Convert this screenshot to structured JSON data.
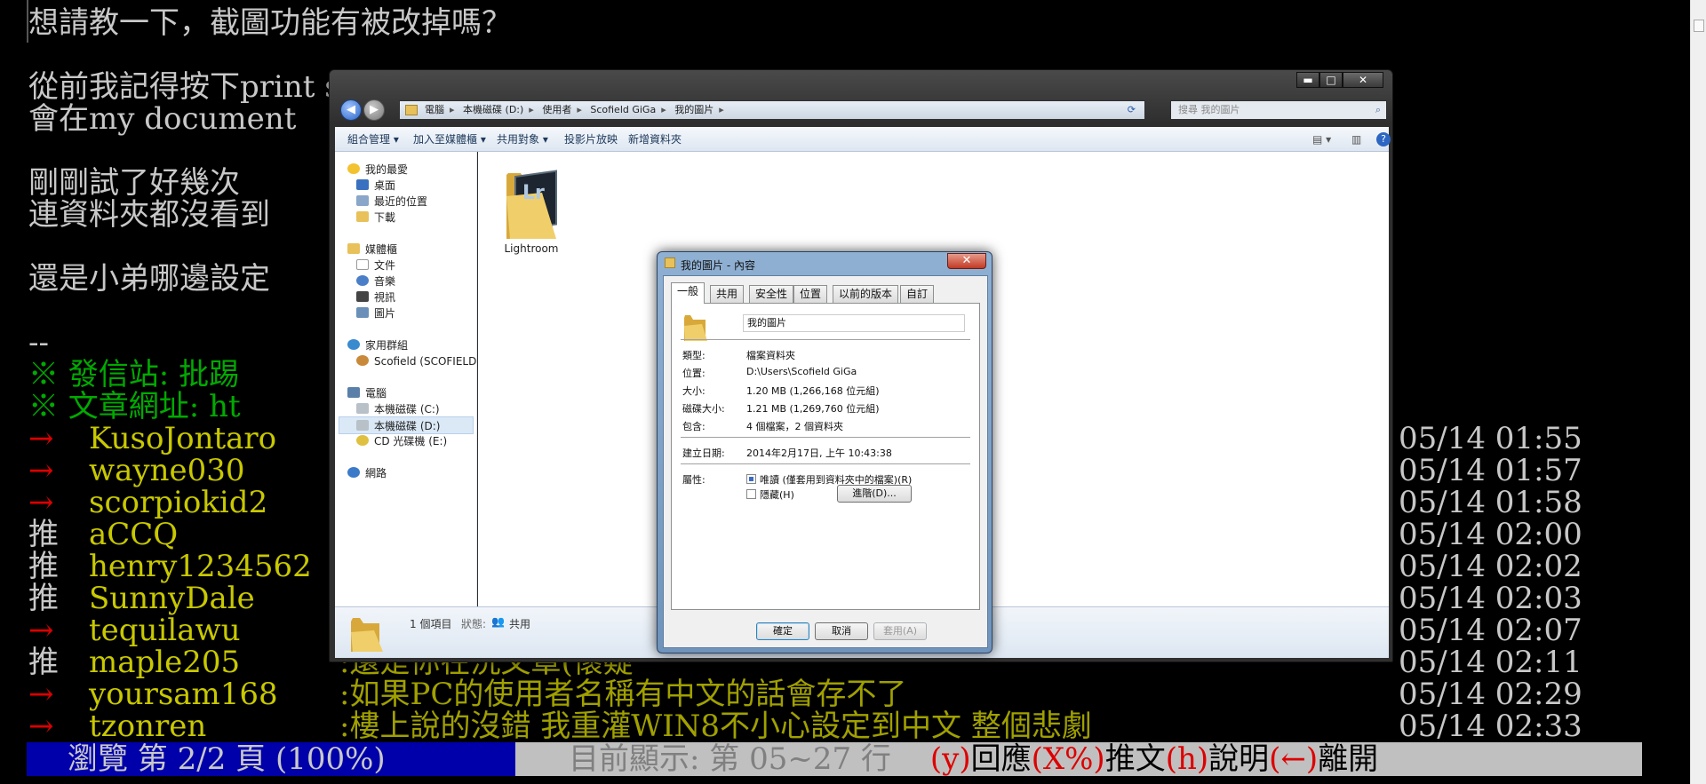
{
  "terminal": {
    "lines": [
      "想請教一下，截圖功能有被改掉嗎？",
      "",
      "從前我記得按下print screen",
      "會在my document",
      "",
      "剛剛試了好幾次",
      "連資料夾都沒看到",
      "",
      "還是小弟哪邊設定",
      "",
      "--",
      "※ 發信站: 批踢",
      "※ 文章網址: ht"
    ],
    "pushes": [
      {
        "tag": "→",
        "user": "KusoJontaro",
        "text": "",
        "time": "05/14 01:55"
      },
      {
        "tag": "→",
        "user": "wayne030",
        "text": "",
        "time": "05/14 01:57"
      },
      {
        "tag": "→",
        "user": "scorpiokid2",
        "text": "",
        "time": "05/14 01:58"
      },
      {
        "tag": "推",
        "user": "aCCQ",
        "text": "",
        "time": "05/14 02:00"
      },
      {
        "tag": "推",
        "user": "henry1234562",
        "text": "",
        "time": "05/14 02:02"
      },
      {
        "tag": "推",
        "user": "SunnyDale",
        "text": "",
        "time": "05/14 02:03"
      },
      {
        "tag": "→",
        "user": "tequilawu",
        "text": "",
        "time": "05/14 02:07"
      },
      {
        "tag": "推",
        "user": "maple205",
        "text": ":還是你在洗文章(懷疑",
        "time": "05/14 02:11"
      },
      {
        "tag": "→",
        "user": "yoursam168",
        "text": ":如果PC的使用者名稱有中文的話會存不了",
        "time": "05/14 02:29"
      },
      {
        "tag": "→",
        "user": "tzonren",
        "text": ":樓上說的沒錯 我重灌WIN8不小心設定到中文 整個悲劇",
        "time": "05/14 02:33"
      }
    ],
    "status_left": "瀏覽 第 2/2 頁 (100%)",
    "status_mid": "目前顯示: 第 05~27 行",
    "status_keys": [
      {
        "key": "(y)",
        "label": "回應"
      },
      {
        "key": "(X%)",
        "label": "推文"
      },
      {
        "key": "(h)",
        "label": "說明"
      },
      {
        "key": "(←)",
        "label": "離開"
      }
    ]
  },
  "explorer": {
    "breadcrumb": [
      "電腦",
      "本機磁碟 (D:)",
      "使用者",
      "Scofield GiGa",
      "我的圖片"
    ],
    "search_placeholder": "搜尋 我的圖片",
    "toolbar": [
      "組合管理 ▾",
      "加入至媒體櫃 ▾",
      "共用對象 ▾",
      "投影片放映",
      "新增資料夾"
    ],
    "nav": {
      "favorites": "我的最愛",
      "favorites_items": [
        "桌面",
        "最近的位置",
        "下載"
      ],
      "libraries": "媒體櫃",
      "libraries_items": [
        "文件",
        "音樂",
        "視訊",
        "圖片"
      ],
      "homegroup": "家用群組",
      "homegroup_items": [
        "Scofield (SCOFIELD"
      ],
      "computer": "電腦",
      "computer_items": [
        "本機磁碟 (C:)",
        "本機磁碟 (D:)",
        "CD 光碟機 (E:)"
      ],
      "network": "網路"
    },
    "folder_label": "Lightroom",
    "folder_icon_text": "Lr",
    "details": {
      "count": "1 個項目",
      "state_label": "狀態:",
      "state": "共用"
    }
  },
  "properties": {
    "title": "我的圖片 - 內容",
    "tabs": [
      "一般",
      "共用",
      "安全性",
      "位置",
      "以前的版本",
      "自訂"
    ],
    "name": "我的圖片",
    "rows": [
      {
        "label": "類型:",
        "value": "檔案資料夾"
      },
      {
        "label": "位置:",
        "value": "D:\\Users\\Scofield GiGa"
      },
      {
        "label": "大小:",
        "value": "1.20 MB (1,266,168 位元組)"
      },
      {
        "label": "磁碟大小:",
        "value": "1.21 MB (1,269,760 位元組)"
      },
      {
        "label": "包含:",
        "value": "4 個檔案，2 個資料夾"
      }
    ],
    "created_label": "建立日期:",
    "created": "2014年2月17日, 上午 10:43:38",
    "attr_label": "屬性:",
    "readonly": "唯讀 (僅套用到資料夾中的檔案)(R)",
    "hidden": "隱藏(H)",
    "advanced": "進階(D)...",
    "ok": "確定",
    "cancel": "取消",
    "apply": "套用(A)"
  }
}
